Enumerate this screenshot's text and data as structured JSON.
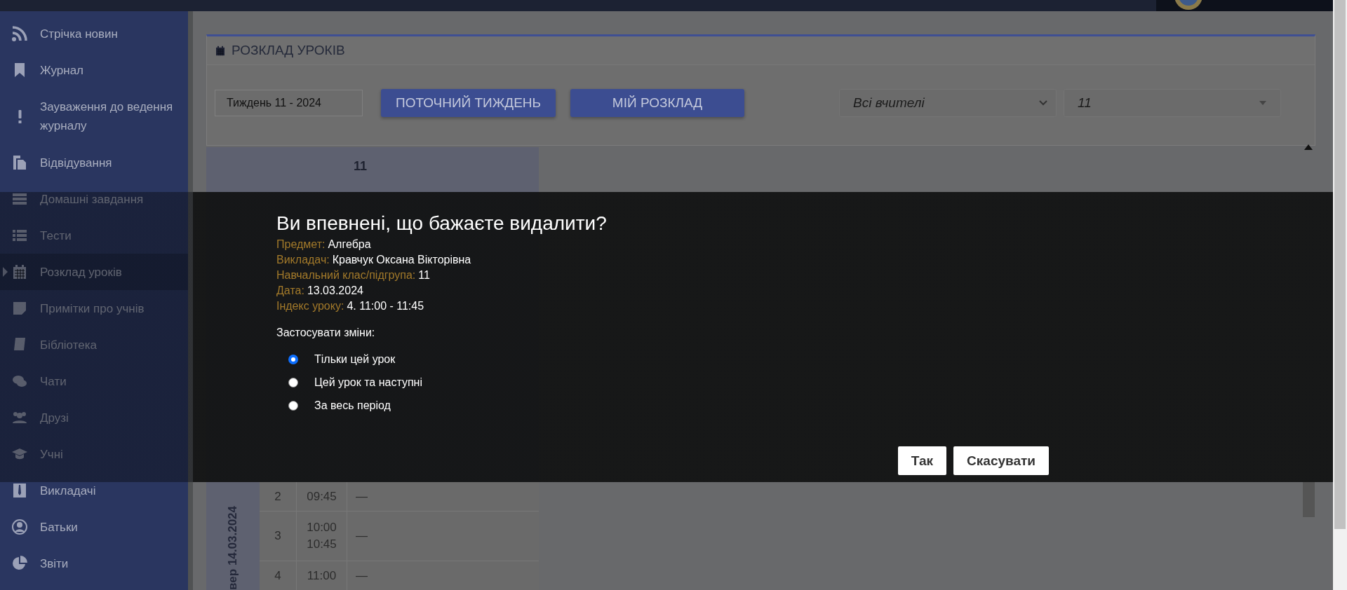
{
  "sidebar": {
    "items": [
      {
        "label": "Стрічка новин",
        "selected": false
      },
      {
        "label": "Журнал",
        "selected": false
      },
      {
        "label": "Зауваження до ведення журналу",
        "selected": false
      },
      {
        "label": "Відвідування",
        "selected": false
      },
      {
        "label": "Домашні завдання",
        "selected": false
      },
      {
        "label": "Тести",
        "selected": false
      },
      {
        "label": "Розклад уроків",
        "selected": true
      },
      {
        "label": "Примітки про учнів",
        "selected": false
      },
      {
        "label": "Бібліотека",
        "selected": false
      },
      {
        "label": "Чати",
        "selected": false
      },
      {
        "label": "Друзі",
        "selected": false
      },
      {
        "label": "Учні",
        "selected": false
      },
      {
        "label": "Викладачі",
        "selected": false
      },
      {
        "label": "Батьки",
        "selected": false
      },
      {
        "label": "Звіти",
        "selected": false
      }
    ]
  },
  "schedule": {
    "title": "РОЗКЛАД УРОКІВ",
    "week_field": {
      "value": "Тиждень 11 - 2024"
    },
    "buttons": [
      "ПОТОЧНИЙ ТИЖДЕНЬ",
      "МІЙ РОЗКЛАД"
    ],
    "teacher_select": {
      "value": "Всі вчителі"
    },
    "class_select": {
      "value": "11"
    },
    "table": {
      "header": "11",
      "day": "вер 14.03.2024",
      "rows": [
        {
          "number": "2",
          "times": [
            "09:45"
          ],
          "lesson": "—"
        },
        {
          "number": "3",
          "times": [
            "10:00",
            "10:45"
          ],
          "lesson": "—"
        },
        {
          "number": "4",
          "times": [
            "11:00"
          ],
          "lesson": "—"
        }
      ]
    }
  },
  "dialog": {
    "title": "Ви впевнені, що бажаєте видалити?",
    "fields": [
      {
        "label": "Предмет:",
        "value": "Алгебра"
      },
      {
        "label": "Викладач:",
        "value": "Кравчук Оксана Вікторівна"
      },
      {
        "label": "Навчальний клас/підгрупа:",
        "value": "11"
      },
      {
        "label": "Дата:",
        "value": "13.03.2024"
      },
      {
        "label": "Індекс уроку:",
        "value": "4. 11:00 - 11:45"
      }
    ],
    "apply_label": "Застосувати зміни:",
    "options": [
      {
        "label": "Тільки цей урок",
        "selected": true
      },
      {
        "label": "Цей урок та наступні",
        "selected": false
      },
      {
        "label": "За весь період",
        "selected": false
      }
    ],
    "buttons": [
      "Так",
      "Скасувати"
    ]
  }
}
